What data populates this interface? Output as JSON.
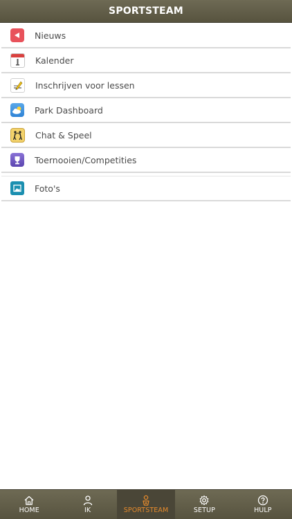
{
  "header": {
    "title": "SPORTSTEAM"
  },
  "menu": {
    "items": [
      {
        "label": "Nieuws",
        "icon": "megaphone-icon"
      },
      {
        "label": "Kalender",
        "icon": "calendar-icon"
      },
      {
        "label": "Inschrijven voor lessen",
        "icon": "signup-pencil-icon"
      },
      {
        "label": "Park Dashboard",
        "icon": "weather-cloud-icon"
      },
      {
        "label": "Chat & Speel",
        "icon": "chat-play-icon"
      },
      {
        "label": "Toernooien/Competities",
        "icon": "trophy-icon"
      },
      {
        "label": "Foto's",
        "icon": "photo-icon"
      }
    ]
  },
  "nav": {
    "items": [
      {
        "label": "HOME",
        "icon": "home-icon"
      },
      {
        "label": "IK",
        "icon": "user-icon"
      },
      {
        "label": "SPORTSTEAM",
        "icon": "sportsteam-icon",
        "active": true
      },
      {
        "label": "SETUP",
        "icon": "gear-icon"
      },
      {
        "label": "HULP",
        "icon": "help-icon"
      }
    ]
  },
  "colors": {
    "bar": "#5f5b46",
    "active_tab_text": "#e58a2c",
    "divider": "#d9d9d9"
  }
}
